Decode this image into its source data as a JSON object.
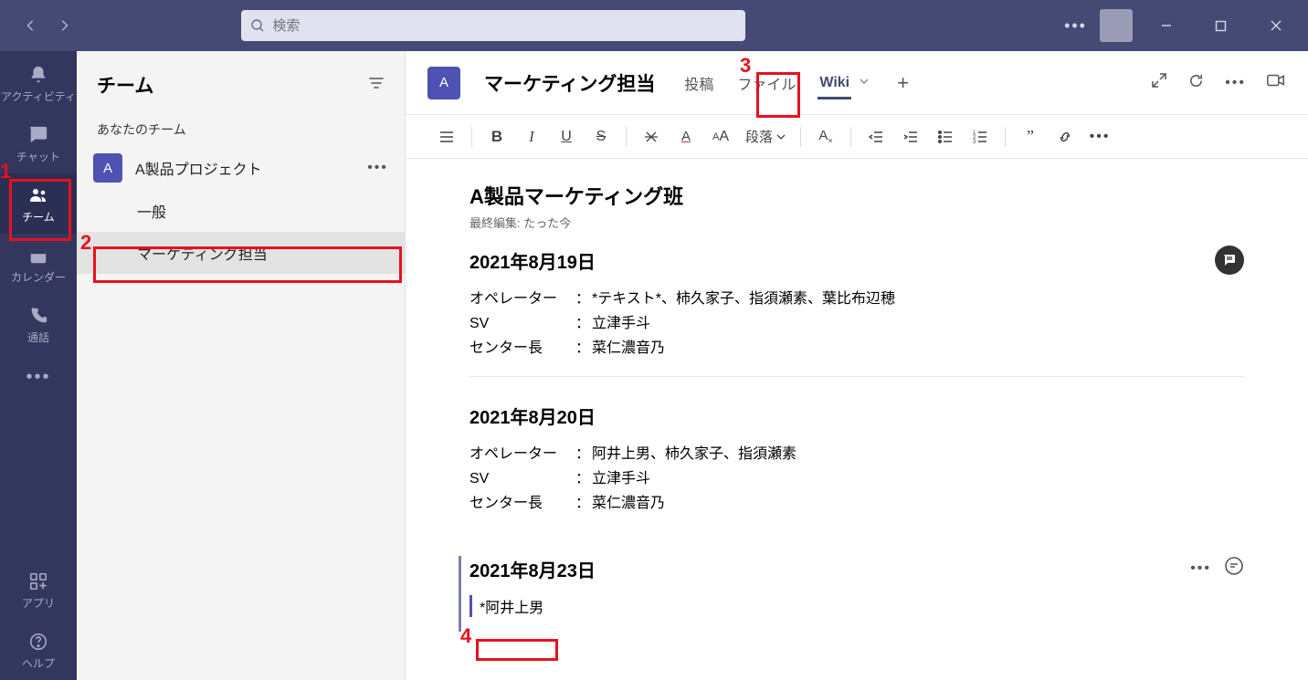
{
  "search": {
    "placeholder": "検索"
  },
  "rail": {
    "activity": "アクティビティ",
    "chat": "チャット",
    "teams": "チーム",
    "calendar": "カレンダー",
    "calls": "通話",
    "apps": "アプリ",
    "help": "ヘルプ"
  },
  "sidebar": {
    "title": "チーム",
    "your_teams": "あなたのチーム",
    "team": {
      "avatar": "A",
      "name": "A製品プロジェクト"
    },
    "channels": [
      "一般",
      "マーケティング担当"
    ]
  },
  "header": {
    "avatar": "A",
    "title": "マーケティング担当",
    "tabs": [
      "投稿",
      "ファイル",
      "Wiki"
    ]
  },
  "toolbar": {
    "paragraph": "段落"
  },
  "wiki": {
    "title": "A製品マーケティング班",
    "last_edit": "最終編集: たった今",
    "sections": [
      {
        "heading": "2021年8月19日",
        "rows": [
          {
            "label": "オペレーター",
            "value": "*テキスト*、柿久家子、指須瀬素、葉比布辺穂"
          },
          {
            "label": "SV",
            "value": "立津手斗"
          },
          {
            "label": "センター長",
            "value": "菜仁濃音乃"
          }
        ]
      },
      {
        "heading": "2021年8月20日",
        "rows": [
          {
            "label": "オペレーター",
            "value": "阿井上男、柿久家子、指須瀬素"
          },
          {
            "label": "SV",
            "value": "立津手斗"
          },
          {
            "label": "センター長",
            "value": "菜仁濃音乃"
          }
        ]
      },
      {
        "heading": "2021年8月23日",
        "edit_text": "*阿井上男"
      }
    ]
  },
  "annotations": {
    "n1": "1",
    "n2": "2",
    "n3": "3",
    "n4": "4"
  }
}
